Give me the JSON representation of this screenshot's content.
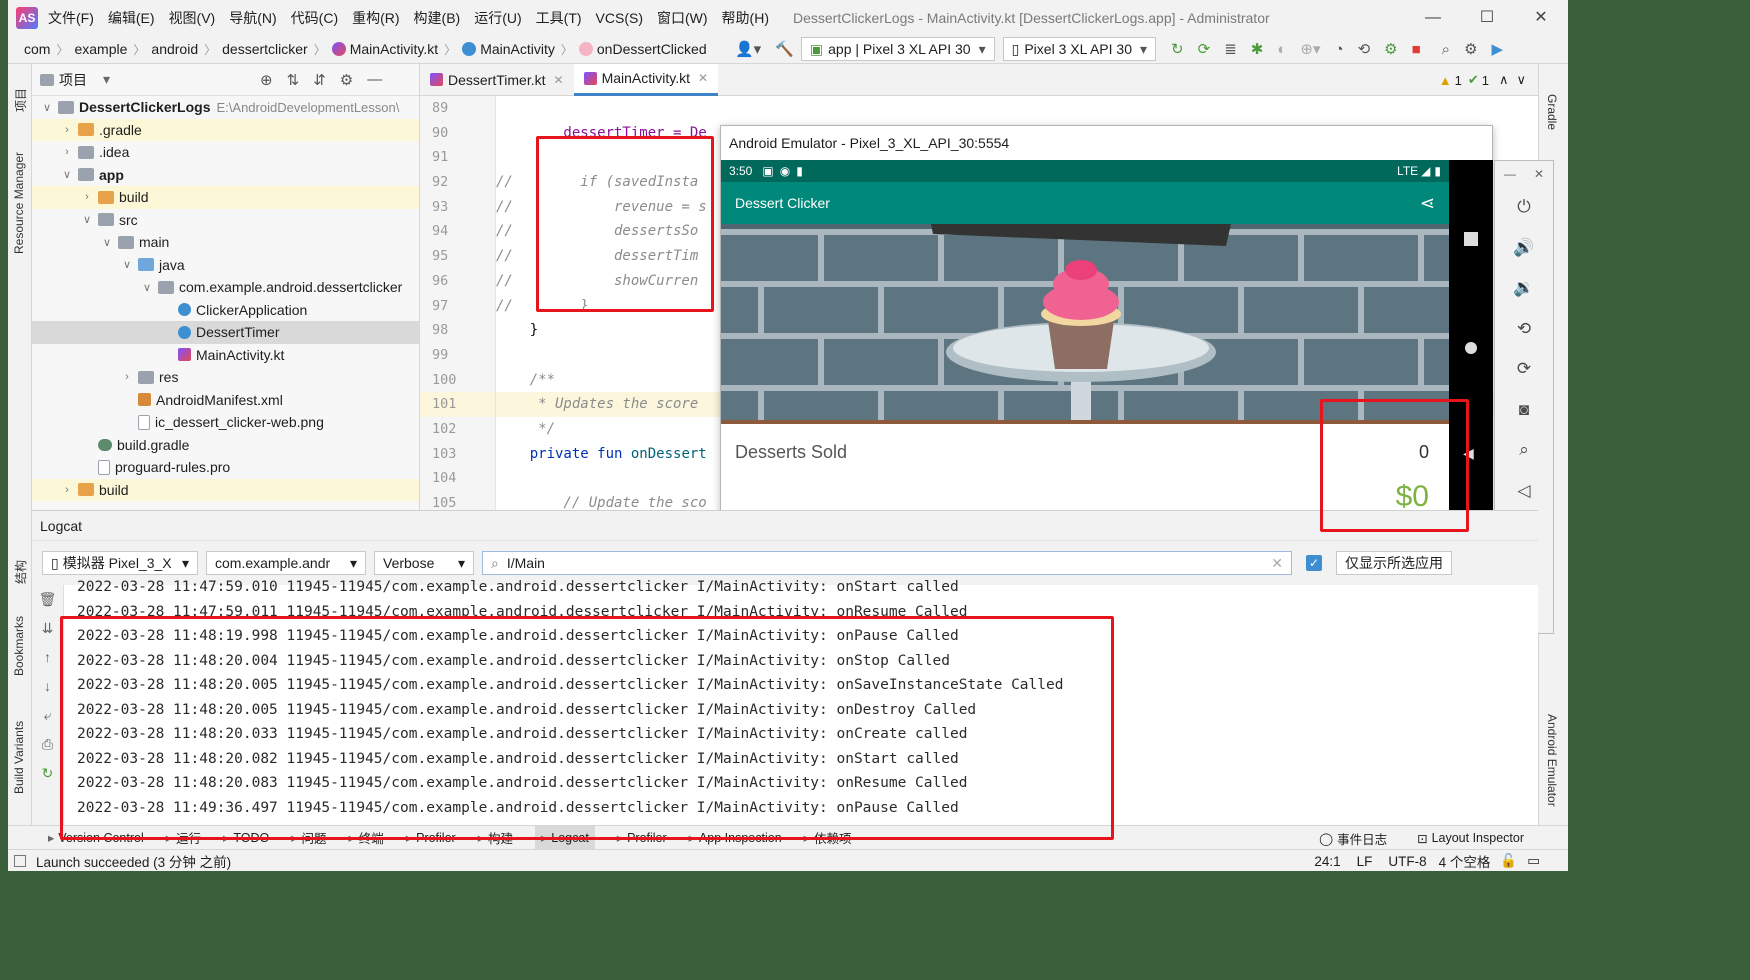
{
  "titlebar": {
    "menus": [
      "文件(F)",
      "编辑(E)",
      "视图(V)",
      "导航(N)",
      "代码(C)",
      "重构(R)",
      "构建(B)",
      "运行(U)",
      "工具(T)",
      "VCS(S)",
      "窗口(W)",
      "帮助(H)"
    ],
    "title": "DessertClickerLogs - MainActivity.kt [DessertClickerLogs.app] - Administrator"
  },
  "navbar": {
    "breadcrumbs": [
      "com",
      "example",
      "android",
      "dessertclicker",
      "MainActivity.kt",
      "MainActivity",
      "onDessertClicked"
    ],
    "run_config": "app | Pixel 3 XL API 30",
    "device": "Pixel 3 XL API 30"
  },
  "leftstrip": {
    "labels": [
      "项目",
      "Resource Manager",
      "结构",
      "Bookmarks",
      "Build Variants"
    ]
  },
  "rightstrip": {
    "labels": [
      "Gradle",
      "Android Emulator"
    ]
  },
  "project": {
    "header": "项目",
    "items": [
      {
        "label": "DessertClickerLogs",
        "extra": "E:\\AndroidDevelopmentLesson\\",
        "depth": 0,
        "arrow": "v",
        "icon": "folder",
        "bold": true
      },
      {
        "label": ".gradle",
        "depth": 1,
        "arrow": ">",
        "icon": "ofolder",
        "hl": true
      },
      {
        "label": ".idea",
        "depth": 1,
        "arrow": ">",
        "icon": "folder"
      },
      {
        "label": "app",
        "depth": 1,
        "arrow": "v",
        "icon": "folder",
        "bold": true
      },
      {
        "label": "build",
        "depth": 2,
        "arrow": ">",
        "icon": "ofolder",
        "hl": true
      },
      {
        "label": "src",
        "depth": 2,
        "arrow": "v",
        "icon": "folder"
      },
      {
        "label": "main",
        "depth": 3,
        "arrow": "v",
        "icon": "folder"
      },
      {
        "label": "java",
        "depth": 4,
        "arrow": "v",
        "icon": "jfolder"
      },
      {
        "label": "com.example.android.dessertclicker",
        "depth": 5,
        "arrow": "v",
        "icon": "folder"
      },
      {
        "label": "ClickerApplication",
        "depth": 6,
        "arrow": "",
        "icon": "cls"
      },
      {
        "label": "DessertTimer",
        "depth": 6,
        "arrow": "",
        "icon": "cls",
        "sel": true
      },
      {
        "label": "MainActivity.kt",
        "depth": 6,
        "arrow": "",
        "icon": "kt"
      },
      {
        "label": "res",
        "depth": 4,
        "arrow": ">",
        "icon": "folder"
      },
      {
        "label": "AndroidManifest.xml",
        "depth": 4,
        "arrow": "",
        "icon": "xml"
      },
      {
        "label": "ic_dessert_clicker-web.png",
        "depth": 4,
        "arrow": "",
        "icon": "file"
      },
      {
        "label": "build.gradle",
        "depth": 2,
        "arrow": "",
        "icon": "gradle"
      },
      {
        "label": "proguard-rules.pro",
        "depth": 2,
        "arrow": "",
        "icon": "file"
      },
      {
        "label": "build",
        "depth": 1,
        "arrow": ">",
        "icon": "ofolder",
        "hl": true
      }
    ]
  },
  "editor": {
    "tabs": [
      {
        "label": "DessertTimer.kt",
        "active": false
      },
      {
        "label": "MainActivity.kt",
        "active": true
      }
    ],
    "warnings": "1",
    "ok": "1",
    "line_numbers": [
      "89",
      "90",
      "91",
      "92",
      "93",
      "94",
      "95",
      "96",
      "97",
      "98",
      "99",
      "100",
      "101",
      "102",
      "103",
      "104",
      "105"
    ],
    "lines": [
      {
        "text": "",
        "cls": ""
      },
      {
        "text": "        dessertTimer = De",
        "cls": "pr"
      },
      {
        "text": "",
        "cls": ""
      },
      {
        "text": "//        if (savedInsta",
        "cls": "cm"
      },
      {
        "text": "//            revenue = s",
        "cls": "cm"
      },
      {
        "text": "//            dessertsSo",
        "cls": "cm"
      },
      {
        "text": "//            dessertTim",
        "cls": "cm"
      },
      {
        "text": "//            showCurren",
        "cls": "cm"
      },
      {
        "text": "//        }",
        "cls": "cm"
      },
      {
        "text": "    }",
        "cls": ""
      },
      {
        "text": "",
        "cls": ""
      },
      {
        "text": "    /**",
        "cls": "cm"
      },
      {
        "text": "     * Updates the score",
        "cls": "cm"
      },
      {
        "text": "     */",
        "cls": "cm"
      },
      {
        "text": "    private fun onDessert",
        "cls": "mix"
      },
      {
        "text": "",
        "cls": ""
      },
      {
        "text": "        // Update the sco",
        "cls": "cm"
      }
    ]
  },
  "emulator": {
    "title": "Android Emulator - Pixel_3_XL_API_30:5554",
    "time": "3:50",
    "network": "LTE",
    "app_title": "Dessert Clicker",
    "desserts_sold_label": "Desserts Sold",
    "desserts_sold_value": "0",
    "revenue": "$0"
  },
  "logcat": {
    "header": "Logcat",
    "device": "模拟器 Pixel_3_X",
    "package": "com.example.andr",
    "level": "Verbose",
    "search": "I/Main",
    "only_selected": "仅显示所选应用",
    "lines": [
      "2022-03-28 11:47:59.010 11945-11945/com.example.android.dessertclicker I/MainActivity: onStart called",
      "2022-03-28 11:47:59.011 11945-11945/com.example.android.dessertclicker I/MainActivity: onResume Called",
      "2022-03-28 11:48:19.998 11945-11945/com.example.android.dessertclicker I/MainActivity: onPause Called",
      "2022-03-28 11:48:20.004 11945-11945/com.example.android.dessertclicker I/MainActivity: onStop Called",
      "2022-03-28 11:48:20.005 11945-11945/com.example.android.dessertclicker I/MainActivity: onSaveInstanceState Called",
      "2022-03-28 11:48:20.005 11945-11945/com.example.android.dessertclicker I/MainActivity: onDestroy Called",
      "2022-03-28 11:48:20.033 11945-11945/com.example.android.dessertclicker I/MainActivity: onCreate called",
      "2022-03-28 11:48:20.082 11945-11945/com.example.android.dessertclicker I/MainActivity: onStart called",
      "2022-03-28 11:48:20.083 11945-11945/com.example.android.dessertclicker I/MainActivity: onResume Called",
      "2022-03-28 11:49:36.497 11945-11945/com.example.android.dessertclicker I/MainActivity: onPause Called"
    ]
  },
  "bottombar": {
    "tools": [
      "Version Control",
      "运行",
      "TODO",
      "问题",
      "终端",
      "Profiler",
      "构建",
      "Logcat",
      "Profiler",
      "App Inspection",
      "依赖项"
    ],
    "active": "Logcat",
    "right": [
      "事件日志",
      "Layout Inspector"
    ]
  },
  "status": {
    "message": "Launch succeeded (3 分钟 之前)",
    "position": "24:1",
    "line_sep": "LF",
    "encoding": "UTF-8",
    "indent": "4 个空格"
  },
  "colors": {
    "accent": "#4083c9",
    "highlight_box": "#e8141c",
    "app_bar": "#00897b",
    "revenue": "#7cb342"
  }
}
